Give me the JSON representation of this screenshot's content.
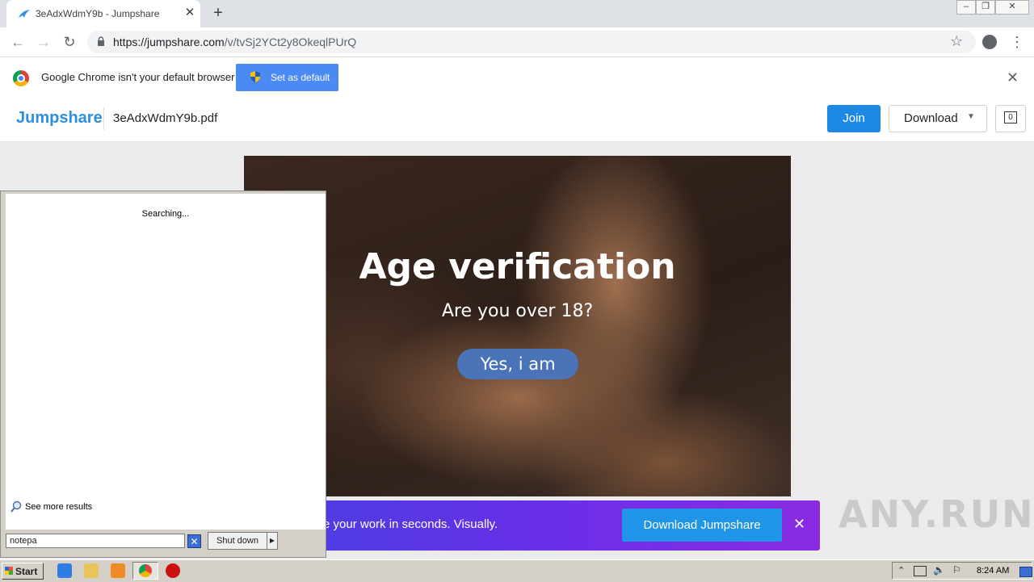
{
  "browser": {
    "tab_title": "3eAdxWdmY9b - Jumpshare",
    "tab_close": "✕",
    "new_tab": "+",
    "url_host": "https://jumpshare.com",
    "url_path": "/v/tvSj2YCt2y8OkeqlPUrQ",
    "window_controls": [
      "minimize",
      "restore",
      "close"
    ]
  },
  "infobar": {
    "message": "Google Chrome isn't your default browser",
    "set_default_label": "Set as default",
    "close": "✕"
  },
  "header": {
    "brand": "Jumpshare",
    "filename": "3eAdxWdmY9b.pdf",
    "join_label": "Join",
    "download_label": "Download",
    "comment_count": "0"
  },
  "document": {
    "title": "Age verification",
    "question": "Are you over 18?",
    "confirm_label": "Yes, i am"
  },
  "promo": {
    "text": "e your work in seconds. Visually.",
    "button_label": "Download Jumpshare",
    "close": "✕"
  },
  "watermark": "ANY.RUN",
  "start_search": {
    "status": "Searching...",
    "see_more": "See more results",
    "query": "notepa",
    "shutdown_label": "Shut down"
  },
  "taskbar": {
    "start_label": "Start",
    "pinned": [
      "ie-icon",
      "explorer-icon",
      "media-player-icon",
      "chrome-icon",
      "opera-icon"
    ],
    "clock": "8:24 AM"
  },
  "colors": {
    "brand": "#2d8fe2",
    "join": "#1e88e5",
    "set_default": "#4a8af4",
    "verify_button": "#4b73b8"
  }
}
